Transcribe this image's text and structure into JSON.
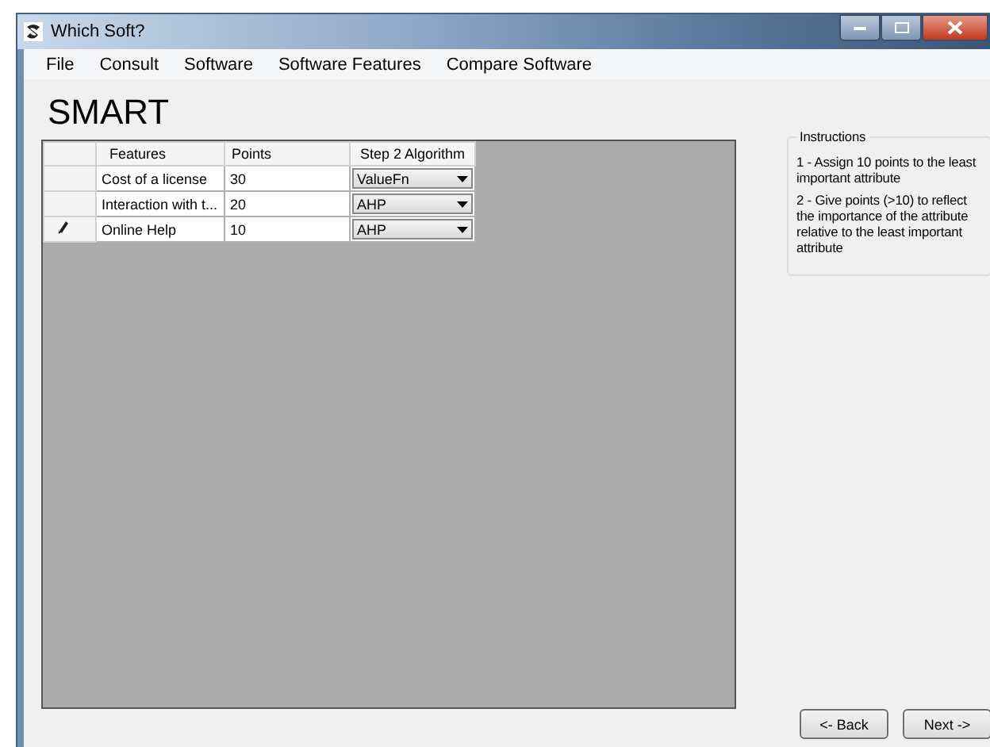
{
  "window": {
    "title": "Which Soft?"
  },
  "menu": [
    "File",
    "Consult",
    "Software",
    "Software Features",
    "Compare Software"
  ],
  "heading": "SMART",
  "table": {
    "columns": [
      "Features",
      "Points",
      "Step 2 Algorithm"
    ],
    "rows": [
      {
        "feature": "Cost of a license",
        "points": "30",
        "algorithm": "ValueFn",
        "editing": false
      },
      {
        "feature": "Interaction with t...",
        "points": "20",
        "algorithm": "AHP",
        "editing": false
      },
      {
        "feature": "Online Help",
        "points": "10",
        "algorithm": "AHP",
        "editing": true
      }
    ]
  },
  "instructions": {
    "title": "Instructions",
    "items": [
      "1 - Assign 10 points to the least important attribute",
      "2 - Give points (>10) to reflect the importance of the attribute relative to the least important attribute"
    ]
  },
  "buttons": [
    "<- Back",
    "Next ->"
  ]
}
